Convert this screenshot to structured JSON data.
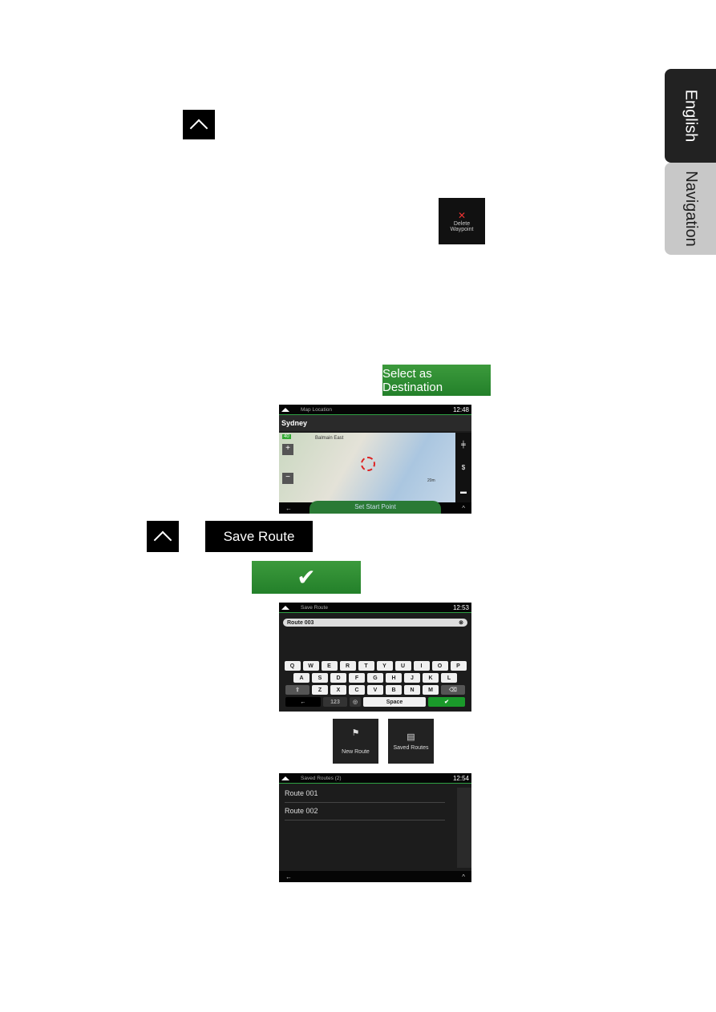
{
  "side_tabs": [
    {
      "label": "English",
      "color": "#222222"
    },
    {
      "label": "Navigation",
      "color": "#c8c8c8"
    }
  ],
  "buttons": {
    "delete_waypoint": "Delete Waypoint",
    "select_as_destination": "Select as Destination",
    "save_route": "Save Route",
    "new_route": "New Route",
    "saved_routes": "Saved Routes"
  },
  "map_screen": {
    "title": "Map Location",
    "time": "12:48",
    "location": "Sydney",
    "map_label": "Balmain East",
    "speed": "40",
    "scale": "20m",
    "action": "Set Start Point"
  },
  "save_screen": {
    "title": "Save Route",
    "time": "12:53",
    "input_value": "Route 003",
    "keys_row1": [
      "Q",
      "W",
      "E",
      "R",
      "T",
      "Y",
      "U",
      "I",
      "O",
      "P"
    ],
    "keys_row2": [
      "A",
      "S",
      "D",
      "F",
      "G",
      "H",
      "J",
      "K",
      "L"
    ],
    "keys_row3": [
      "Z",
      "X",
      "C",
      "V",
      "B",
      "N",
      "M"
    ],
    "numbers_key": "123",
    "space_key": "Space"
  },
  "saved_screen": {
    "title": "Saved Routes (2)",
    "time": "12:54",
    "routes": [
      "Route 001",
      "Route 002"
    ]
  },
  "accent": "#2ea043"
}
